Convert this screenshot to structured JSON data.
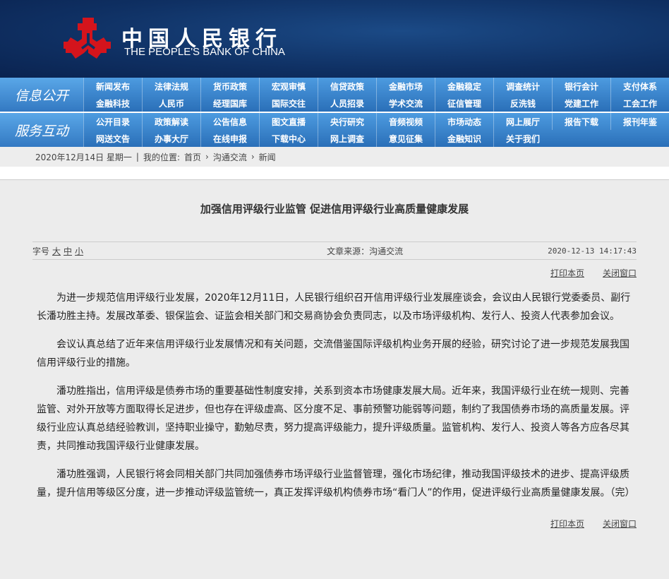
{
  "header": {
    "logo_cn": "中国人民银行",
    "logo_en": "THE PEOPLE'S BANK OF CHINA",
    "brand_color": "#d4141c"
  },
  "nav": [
    {
      "label": "信息公开",
      "items": [
        "新闻发布",
        "法律法规",
        "货币政策",
        "宏观审慎",
        "信贷政策",
        "金融市场",
        "金融稳定",
        "调查统计",
        "银行会计",
        "支付体系",
        "金融科技",
        "人民币",
        "经理国库",
        "国际交往",
        "人员招录",
        "学术交流",
        "征信管理",
        "反洗钱",
        "党建工作",
        "工会工作"
      ]
    },
    {
      "label": "服务互动",
      "items": [
        "公开目录",
        "政策解读",
        "公告信息",
        "图文直播",
        "央行研究",
        "音频视频",
        "市场动态",
        "网上展厅",
        "报告下载",
        "报刊年鉴",
        "网送文告",
        "办事大厅",
        "在线申报",
        "下载中心",
        "网上调查",
        "意见征集",
        "金融知识",
        "关于我们"
      ]
    }
  ],
  "breadcrumb": {
    "date": "2020年12月14日 星期一",
    "sep": "|",
    "location_label": "我的位置:",
    "items": [
      "首页",
      "沟通交流",
      "新闻"
    ],
    "arrow": "›"
  },
  "article": {
    "title": "加强信用评级行业监管 促进信用评级行业高质量健康发展",
    "font_size_label": "字号",
    "sizes": [
      "大",
      "中",
      "小"
    ],
    "source": "文章来源：沟通交流",
    "datetime": "2020-12-13 14:17:43",
    "print": "打印本页",
    "close": "关闭窗口",
    "paragraphs": [
      "为进一步规范信用评级行业发展，2020年12月11日，人民银行组织召开信用评级行业发展座谈会，会议由人民银行党委委员、副行长潘功胜主持。发展改革委、银保监会、证监会相关部门和交易商协会负责同志，以及市场评级机构、发行人、投资人代表参加会议。",
      "会议认真总结了近年来信用评级行业发展情况和有关问题，交流借鉴国际评级机构业务开展的经验，研究讨论了进一步规范发展我国信用评级行业的措施。",
      "潘功胜指出，信用评级是债券市场的重要基础性制度安排，关系到资本市场健康发展大局。近年来，我国评级行业在统一规则、完善监管、对外开放等方面取得长足进步，但也存在评级虚高、区分度不足、事前预警功能弱等问题，制约了我国债券市场的高质量发展。评级行业应认真总结经验教训，坚持职业操守，勤勉尽责，努力提高评级能力，提升评级质量。监管机构、发行人、投资人等各方应各尽其责，共同推动我国评级行业健康发展。",
      "潘功胜强调，人民银行将会同相关部门共同加强债券市场评级行业监督管理，强化市场纪律，推动我国评级技术的进步、提高评级质量，提升信用等级区分度，进一步推动评级监管统一，真正发挥评级机构债券市场“看门人”的作用，促进评级行业高质量健康发展。（完）"
    ]
  }
}
